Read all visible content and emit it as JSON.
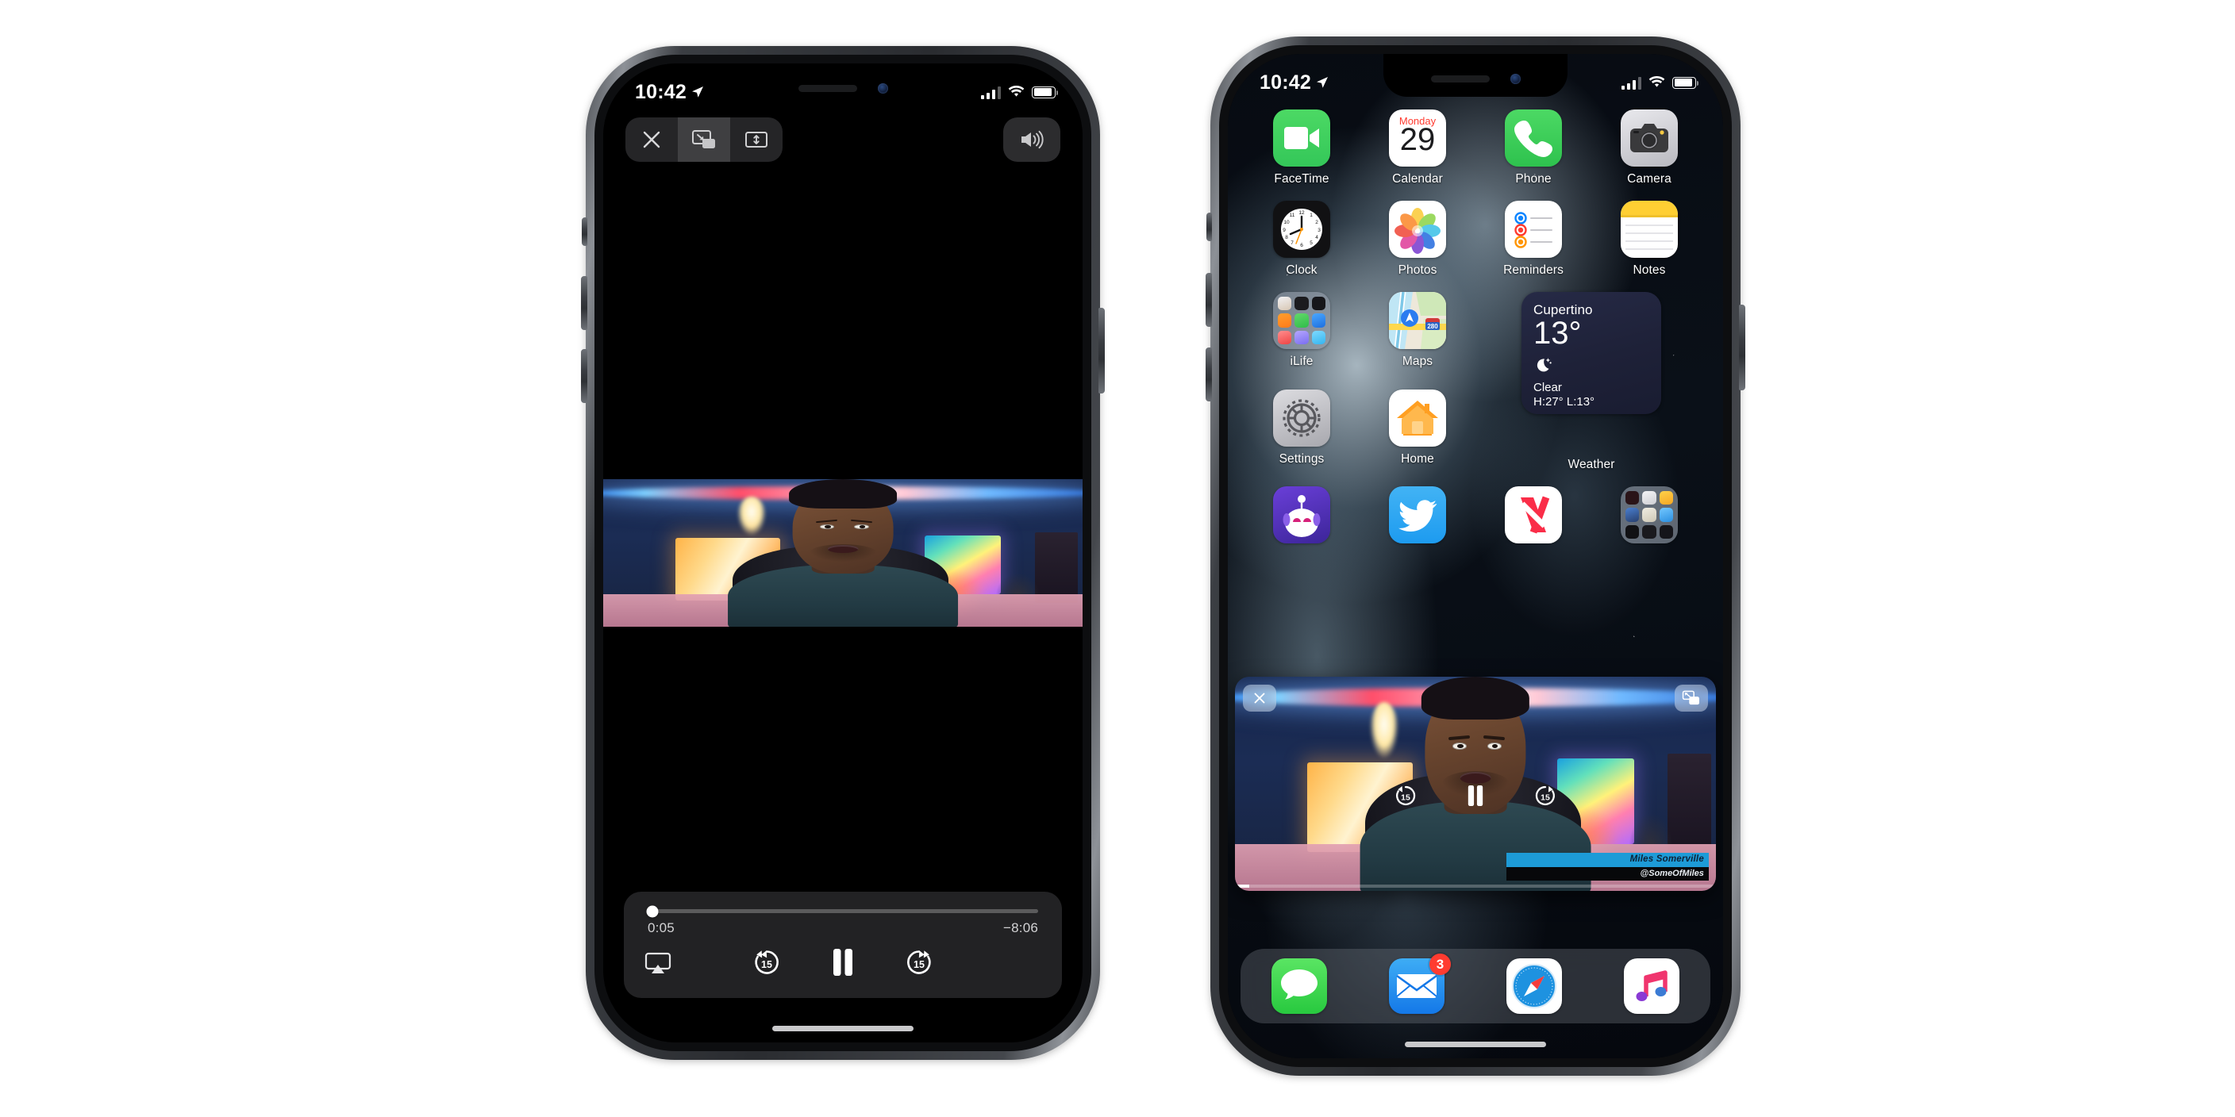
{
  "scene": {
    "background_color": "#ffffff",
    "device_count": 2,
    "device_model": "iPhone"
  },
  "left_phone": {
    "status_bar": {
      "time": "10:42",
      "location_icon": "location-arrow-icon",
      "cellular_icon": "cellular-bars-icon",
      "wifi_icon": "wifi-icon",
      "battery_icon": "battery-icon"
    },
    "player": {
      "top_controls": [
        {
          "name": "close-button",
          "icon": "x-icon",
          "label": "Close"
        },
        {
          "name": "picture-in-picture-button",
          "icon": "pip-enter-icon",
          "label": "Picture in Picture"
        },
        {
          "name": "aspect-ratio-button",
          "icon": "expand-vertical-icon",
          "label": "Fill Screen"
        }
      ],
      "volume_button": {
        "name": "volume-button",
        "icon": "speaker-wave-icon",
        "label": "Volume"
      },
      "scrubber": {
        "elapsed": "0:05",
        "remaining": "−8:06",
        "progress_percent": 1.2
      },
      "transport_controls": [
        {
          "name": "airplay-button",
          "icon": "airplay-icon",
          "label": "AirPlay"
        },
        {
          "name": "rewind-15-button",
          "icon": "rewind-15-icon",
          "label": "15"
        },
        {
          "name": "pause-button",
          "icon": "pause-icon",
          "label": "Pause"
        },
        {
          "name": "forward-15-button",
          "icon": "forward-15-icon",
          "label": "15"
        }
      ],
      "home_indicator": "home-indicator"
    }
  },
  "right_phone": {
    "status_bar": {
      "time": "10:42",
      "location_icon": "location-arrow-icon",
      "cellular_icon": "cellular-bars-icon",
      "wifi_icon": "wifi-icon",
      "battery_icon": "battery-icon"
    },
    "home_screen": {
      "apps": [
        {
          "label": "FaceTime",
          "icon": "facetime-icon"
        },
        {
          "label": "Calendar",
          "icon": "calendar-icon",
          "weekday": "Monday",
          "day": "29"
        },
        {
          "label": "Phone",
          "icon": "phone-icon"
        },
        {
          "label": "Camera",
          "icon": "camera-icon"
        },
        {
          "label": "Clock",
          "icon": "clock-icon"
        },
        {
          "label": "Photos",
          "icon": "photos-icon"
        },
        {
          "label": "Reminders",
          "icon": "reminders-icon"
        },
        {
          "label": "Notes",
          "icon": "notes-icon"
        },
        {
          "label": "iLife",
          "icon": "folder-icon"
        },
        {
          "label": "Maps",
          "icon": "maps-icon"
        },
        {
          "label": "Settings",
          "icon": "settings-icon"
        },
        {
          "label": "Home",
          "icon": "home-icon"
        }
      ],
      "partial_row": [
        {
          "label": "",
          "icon": "apollo-reddit-icon"
        },
        {
          "label": "",
          "icon": "twitter-icon"
        },
        {
          "label": "",
          "icon": "news-icon"
        },
        {
          "label": "",
          "icon": "folder-icon"
        }
      ],
      "weather_widget": {
        "label": "Weather",
        "city": "Cupertino",
        "temperature": "13°",
        "condition_icon": "moon-stars-icon",
        "condition": "Clear",
        "high_low": "H:27° L:13°",
        "accent_color": "#262a46"
      },
      "dock": [
        {
          "label": "Messages",
          "icon": "messages-icon",
          "badge": ""
        },
        {
          "label": "Mail",
          "icon": "mail-icon",
          "badge": "3"
        },
        {
          "label": "Safari",
          "icon": "safari-icon",
          "badge": ""
        },
        {
          "label": "Music",
          "icon": "music-icon",
          "badge": ""
        }
      ],
      "badge_color": "#ff3b30"
    },
    "pip_window": {
      "close_button": {
        "name": "pip-close-button",
        "icon": "x-icon"
      },
      "expand_button": {
        "name": "pip-expand-button",
        "icon": "pip-exit-icon"
      },
      "controls": [
        {
          "name": "rewind-15-button",
          "icon": "rewind-15-icon",
          "label": "15"
        },
        {
          "name": "pause-button",
          "icon": "pause-icon",
          "label": "Pause"
        },
        {
          "name": "forward-15-button",
          "icon": "forward-15-icon",
          "label": "15"
        }
      ],
      "progress_percent": 3
    }
  },
  "video": {
    "lower_third_name": "Miles Somerville",
    "lower_third_handle": "@SomeOfMiles",
    "name_plate_color": "#1d9bd7"
  }
}
